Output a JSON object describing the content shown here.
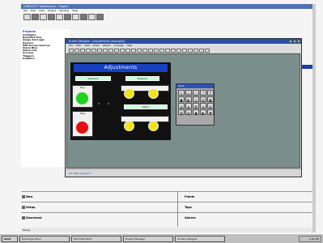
{
  "outer_window": {
    "title": "CIMPLICITY Workbench - Project",
    "menu": [
      "File",
      "Edit",
      "View",
      "Project",
      "Window",
      "Help"
    ]
  },
  "left_panel": {
    "header": "Projects",
    "tree": [
      "Configure",
      "Read/Set Tree",
      "Image Set Logic",
      "Devices",
      "HMI Screen Sources",
      "Alarm Bins",
      "Alarm List",
      "Screens",
      "Triggers",
      "Graphics"
    ]
  },
  "inner_window": {
    "title": "Screen Designer - [Adjustments (example)]",
    "menu": [
      "File",
      "Edit",
      "View",
      "Draw",
      "Object",
      "Arrange",
      "Help"
    ],
    "status": "For Help, press F1"
  },
  "hmi": {
    "title": "Adjustments",
    "top_left_button": "Interlock",
    "top_right_button": "Pressure",
    "left_top_label": "Run",
    "left_bottom_label": "Stop",
    "right_mid_button": "Alarm",
    "lamp_colors": {
      "green": "#1ed21e",
      "red": "#e41010",
      "yellow": "#f2e21a"
    }
  },
  "palette": {
    "title": "Tools",
    "icons": [
      "↖",
      "▭",
      "○",
      "╱",
      "T",
      "▣",
      "◐",
      "◇",
      "⬭",
      "▦",
      "♒",
      "⌂",
      "⚙",
      "≡",
      "◎",
      "▥",
      "▤",
      "◆",
      "▶",
      "✚"
    ]
  },
  "bottom": {
    "rows": [
      {
        "left": "New",
        "right": "Points"
      },
      {
        "left": "Setup",
        "right": "Tags"
      },
      {
        "left": "Download",
        "right": "Alarms"
      }
    ],
    "status": "Ready"
  },
  "taskbar": {
    "tasks": [
      "Start",
      "Exchange Inbox",
      "Microsoft Word",
      "Project Manager",
      "Screen Designer"
    ],
    "clock": "2:41 PM"
  }
}
